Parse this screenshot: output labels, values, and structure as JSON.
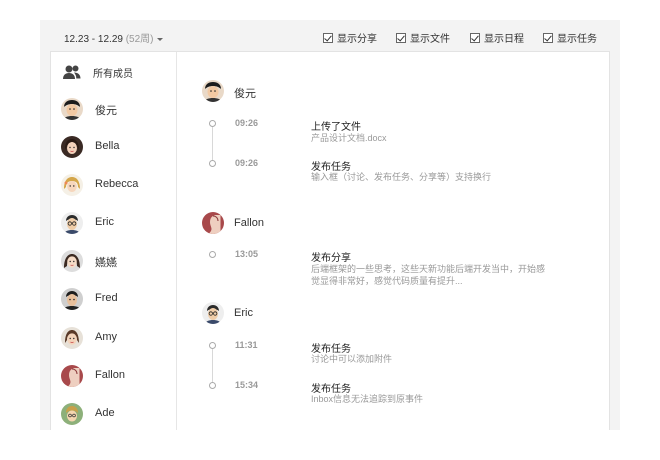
{
  "header": {
    "week_range": "12.23 - 12.29",
    "week_number": "(52周)",
    "filters": [
      {
        "label": "显示分享",
        "checked": true
      },
      {
        "label": "显示文件",
        "checked": true
      },
      {
        "label": "显示日程",
        "checked": true
      },
      {
        "label": "显示任务",
        "checked": true
      }
    ]
  },
  "sidebar": {
    "all_members_label": "所有成员",
    "members": [
      {
        "name": "俊元",
        "icon": "avatar-boy"
      },
      {
        "name": "Bella",
        "icon": "avatar-girl"
      },
      {
        "name": "Rebecca",
        "icon": "avatar-girl-blonde"
      },
      {
        "name": "Eric",
        "icon": "avatar-man-glasses"
      },
      {
        "name": "嬿嬿",
        "icon": "avatar-girl"
      },
      {
        "name": "Fred",
        "icon": "avatar-man"
      },
      {
        "name": "Amy",
        "icon": "avatar-girl"
      },
      {
        "name": "Fallon",
        "icon": "avatar-default-red"
      },
      {
        "name": "Ade",
        "icon": "avatar-man-cartoon"
      }
    ]
  },
  "feed": {
    "groups": [
      {
        "author": "俊元",
        "events": [
          {
            "time": "09:26",
            "title": "上传了文件",
            "desc": "产品设计文档.docx"
          },
          {
            "time": "09:26",
            "title": "发布任务",
            "desc": "输入框（讨论、发布任务、分享等）支持换行"
          }
        ]
      },
      {
        "author": "Fallon",
        "events": [
          {
            "time": "13:05",
            "title": "发布分享",
            "desc": "后端框架的一些思考，这些天新功能后端开发当中，开始感觉显得非常好，感觉代码质量有提升..."
          }
        ]
      },
      {
        "author": "Eric",
        "events": [
          {
            "time": "11:31",
            "title": "发布任务",
            "desc": "讨论中可以添加附件"
          },
          {
            "time": "15:34",
            "title": "发布任务",
            "desc": "Inbox信息无法追踪到原事件"
          }
        ]
      }
    ]
  }
}
